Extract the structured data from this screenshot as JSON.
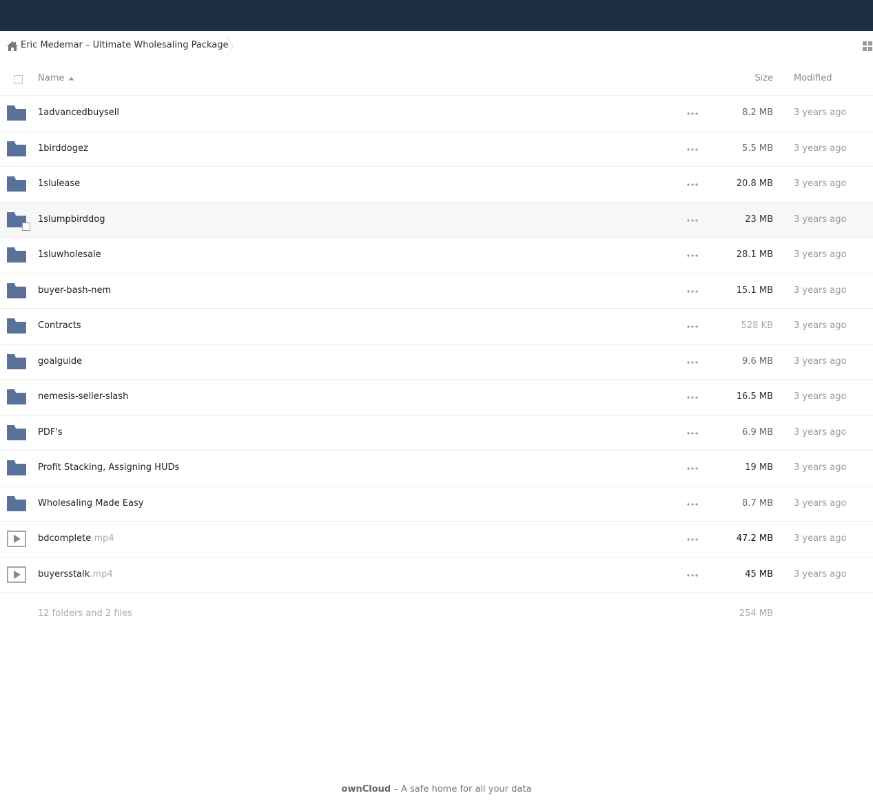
{
  "breadcrumb": {
    "home_icon": "home-icon",
    "current": "Eric Medemar – Ultimate Wholesaling Package"
  },
  "toolbar": {
    "view_toggle_icon": "grid-view-icon"
  },
  "table": {
    "headers": {
      "name": "Name",
      "size": "Size",
      "modified": "Modified"
    },
    "sort": {
      "column": "name",
      "direction": "ascending"
    },
    "rows": [
      {
        "type": "folder",
        "name": "1advancedbuysell",
        "ext": "",
        "size": "8.2 MB",
        "modified": "3 years ago",
        "size_emphasis": "normal"
      },
      {
        "type": "folder",
        "name": "1birddogez",
        "ext": "",
        "size": "5.5 MB",
        "modified": "3 years ago",
        "size_emphasis": "normal"
      },
      {
        "type": "folder",
        "name": "1slulease",
        "ext": "",
        "size": "20.8 MB",
        "modified": "3 years ago",
        "size_emphasis": "strong"
      },
      {
        "type": "folder",
        "name": "1slumpbirddog",
        "ext": "",
        "size": "23 MB",
        "modified": "3 years ago",
        "size_emphasis": "strong"
      },
      {
        "type": "folder",
        "name": "1sluwholesale",
        "ext": "",
        "size": "28.1 MB",
        "modified": "3 years ago",
        "size_emphasis": "strong"
      },
      {
        "type": "folder",
        "name": "buyer-bash-nem",
        "ext": "",
        "size": "15.1 MB",
        "modified": "3 years ago",
        "size_emphasis": "strong"
      },
      {
        "type": "folder",
        "name": "Contracts",
        "ext": "",
        "size": "528 KB",
        "modified": "3 years ago",
        "size_emphasis": "light"
      },
      {
        "type": "folder",
        "name": "goalguide",
        "ext": "",
        "size": "9.6 MB",
        "modified": "3 years ago",
        "size_emphasis": "normal"
      },
      {
        "type": "folder",
        "name": "nemesis-seller-slash",
        "ext": "",
        "size": "16.5 MB",
        "modified": "3 years ago",
        "size_emphasis": "strong"
      },
      {
        "type": "folder",
        "name": "PDF's",
        "ext": "",
        "size": "6.9 MB",
        "modified": "3 years ago",
        "size_emphasis": "normal"
      },
      {
        "type": "folder",
        "name": "Profit Stacking, Assigning HUDs",
        "ext": "",
        "size": "19 MB",
        "modified": "3 years ago",
        "size_emphasis": "strong"
      },
      {
        "type": "folder",
        "name": "Wholesaling Made Easy",
        "ext": "",
        "size": "8.7 MB",
        "modified": "3 years ago",
        "size_emphasis": "normal"
      },
      {
        "type": "video",
        "name": "bdcomplete",
        "ext": ".mp4",
        "size": "47.2 MB",
        "modified": "3 years ago",
        "size_emphasis": "strongest"
      },
      {
        "type": "video",
        "name": "buyersstalk",
        "ext": ".mp4",
        "size": "45 MB",
        "modified": "3 years ago",
        "size_emphasis": "strongest"
      }
    ],
    "hovered_row": 3
  },
  "summary": {
    "text": "12 folders and 2 files",
    "total_size": "254 MB"
  },
  "footer": {
    "brand": "ownCloud",
    "tagline": " – A safe home for all your data"
  },
  "colors": {
    "topbar": "#1d2d44",
    "folder": "#5a7199",
    "size_light": "#aaaaaa",
    "size_normal": "#666666",
    "size_strong": "#333333",
    "size_strongest": "#111111"
  }
}
